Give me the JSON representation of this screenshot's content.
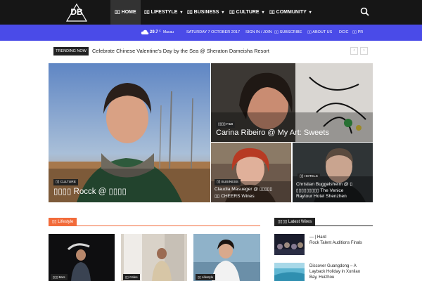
{
  "brand": {
    "logo_text": "DB"
  },
  "nav": {
    "items": [
      {
        "label": "HOME",
        "caret": false
      },
      {
        "label": "LIFESTYLE",
        "caret": true
      },
      {
        "label": "BUSINESS",
        "caret": true
      },
      {
        "label": "CULTURE",
        "caret": true
      },
      {
        "label": "COMMUNITY",
        "caret": true
      }
    ],
    "icon_prefix": "▯▯",
    "search_icon": "search-icon"
  },
  "subbar": {
    "temperature": "29.7",
    "degree": "C",
    "city": "Macau",
    "date": "SATURDAY 7 OCTOBER 2017",
    "sign_in": "SIGN IN / JOIN",
    "subscribe": "SUBSCRIBE",
    "about": "ABOUT US",
    "dcic": "DCIC",
    "lang": "PR"
  },
  "trending": {
    "label": "TRENDING NOW",
    "headline": "Celebrate Chinese Valentine's Day by the Sea @ Sheraton Dameisha Resort",
    "prev": "‹",
    "next": "›"
  },
  "hero": {
    "big": {
      "category": "CULTURE",
      "title": "▯▯▯▯ Rocck @ ▯▯▯▯"
    },
    "top_right": {
      "category": "F&B",
      "title": "Carina Ribeiro @ My Art: Sweets"
    },
    "bottom_left": {
      "category": "BUSINESS",
      "title_l1": "Claudia Masueger @ ▯▯▯▯▯",
      "title_l2": "▯▯ CHEERS Wines"
    },
    "bottom_right": {
      "category": "HOTELS",
      "title_l1": "Christian Buggelsheim @ ▯",
      "title_l2": "▯▯▯▯▯▯▯▯▯ The Venice",
      "title_l3": "Raytour Hotel Shenzhen"
    }
  },
  "lifestyle": {
    "header": "▯▯ Lifestyle",
    "thumbs": [
      {
        "category": "Bars"
      },
      {
        "category": "Cafes"
      },
      {
        "category": "Lifestyle"
      }
    ]
  },
  "wires": {
    "header": "Latest Wires",
    "items": [
      {
        "l1": "—          | Hard",
        "l2": "Rock Talent Auditions Finals"
      },
      {
        "l1": "Discover Guangdong – A",
        "l2": "Layback Holiday in Xunliao",
        "l3": "Bay, Huizhou"
      }
    ]
  },
  "colors": {
    "accent": "#4a4be8",
    "section": "#f26b3a",
    "nav_bg": "#161616"
  }
}
